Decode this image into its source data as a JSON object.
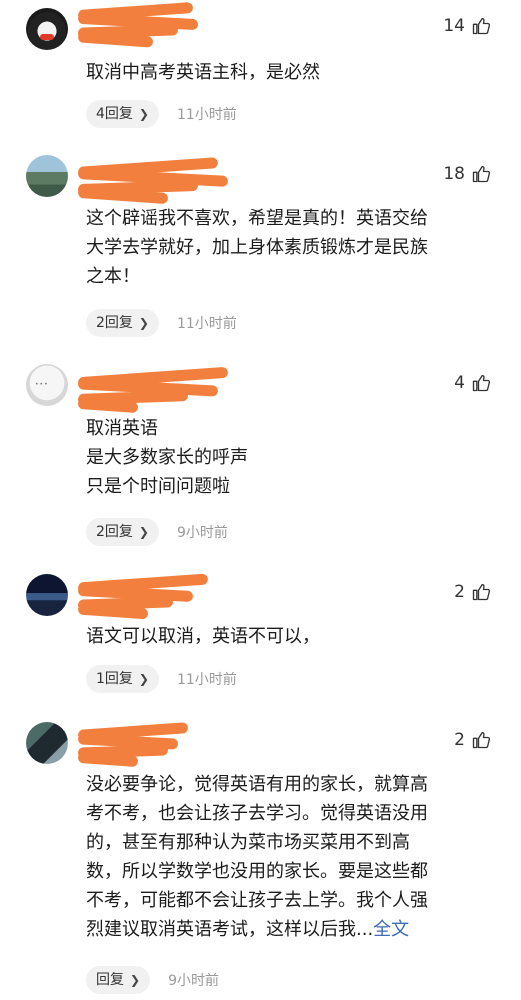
{
  "comments": [
    {
      "likes": "14",
      "text": "取消中高考英语主科，是必然",
      "reply_label": "4回复",
      "time": "11小时前"
    },
    {
      "likes": "18",
      "text": "这个辟谣我不喜欢，希望是真的！英语交给\n大学去学就好，加上身体素质锻炼才是民族\n之本！",
      "reply_label": "2回复",
      "time": "11小时前"
    },
    {
      "likes": "4",
      "text": "取消英语\n是大多数家长的呼声\n只是个时间问题啦",
      "reply_label": "2回复",
      "time": "9小时前"
    },
    {
      "likes": "2",
      "text": "语文可以取消，英语不可以，",
      "reply_label": "1回复",
      "time": "11小时前"
    },
    {
      "likes": "2",
      "text": "没必要争论，觉得英语有用的家长，就算高\n考不考，也会让孩子去学习。觉得英语没用\n的，甚至有那种认为菜市场买菜用不到高\n数，所以学数学也没用的家长。要是这些都\n不考，可能都不会让孩子去上学。我个人强\n烈建议取消英语考试，这样以后我...",
      "more_label": "全文",
      "reply_label": "回复",
      "time": "9小时前"
    }
  ],
  "icons": {
    "like": "thumbs-up-icon",
    "chevron": "chevron-right-icon"
  }
}
